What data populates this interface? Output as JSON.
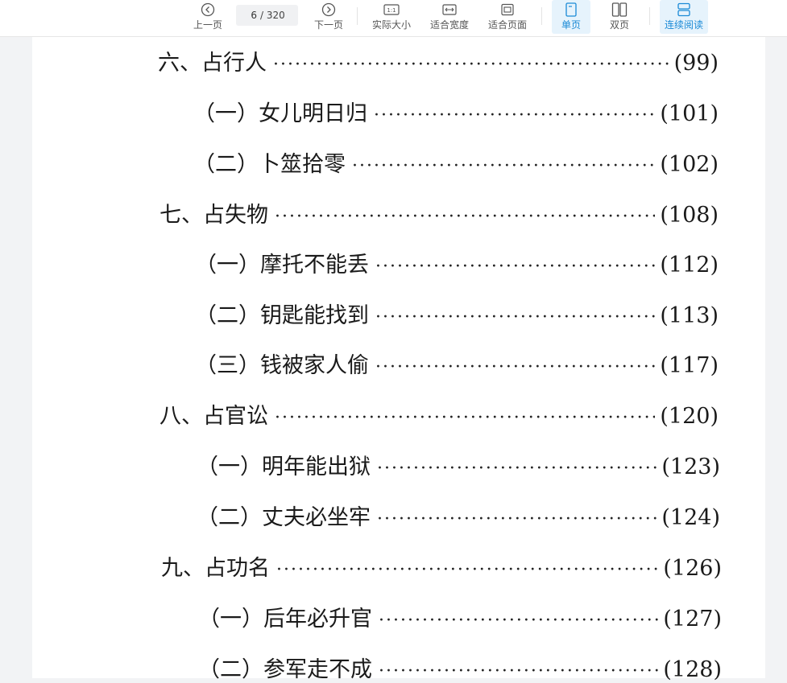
{
  "toolbar": {
    "prev_label": "上一页",
    "next_label": "下一页",
    "current_page": "6",
    "total_pages": "/ 320",
    "actual_size_label": "实际大小",
    "actual_size_icon_text": "1:1",
    "fit_width_label": "适合宽度",
    "fit_page_label": "适合页面",
    "single_page_label": "单页",
    "double_page_label": "双页",
    "continuous_label": "连续阅读",
    "accent_color": "#1a8ad6"
  },
  "toc": [
    {
      "title": "六、占行人",
      "page": "(99)"
    },
    {
      "title": "（一）女儿明日归",
      "page": "(101)"
    },
    {
      "title": "（二）卜筮拾零",
      "page": "(102)"
    },
    {
      "title": "七、占失物",
      "page": "(108)"
    },
    {
      "title": "（一）摩托不能丢",
      "page": "(112)"
    },
    {
      "title": "（二）钥匙能找到",
      "page": "(113)"
    },
    {
      "title": "（三）钱被家人偷",
      "page": "(117)"
    },
    {
      "title": "八、占官讼",
      "page": "(120)"
    },
    {
      "title": "（一）明年能出狱",
      "page": "(123)"
    },
    {
      "title": "（二）丈夫必坐牢",
      "page": "(124)"
    },
    {
      "title": "九、占功名",
      "page": "(126)"
    },
    {
      "title": "（一）后年必升官",
      "page": "(127)"
    },
    {
      "title": "（二）参军走不成",
      "page": "(128)"
    }
  ]
}
